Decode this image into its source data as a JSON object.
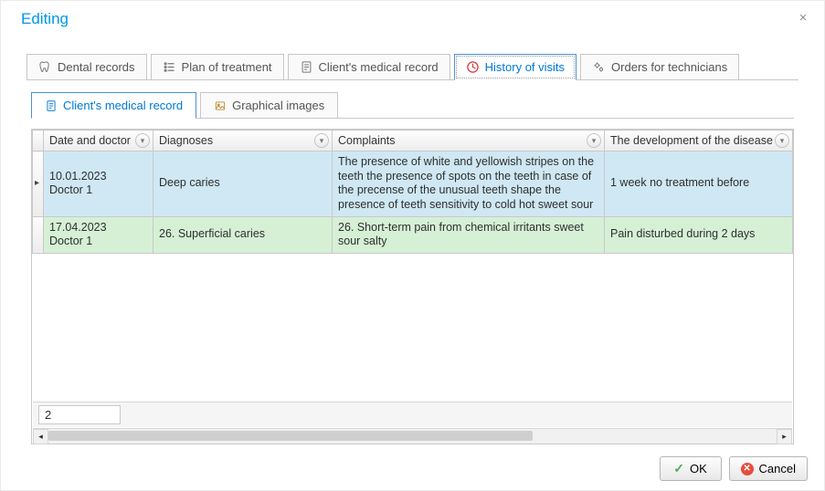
{
  "window": {
    "title": "Editing",
    "close_label": "×"
  },
  "tabs": [
    {
      "label": "Dental records"
    },
    {
      "label": "Plan of treatment"
    },
    {
      "label": "Client's medical record"
    },
    {
      "label": "History of visits",
      "active": true
    },
    {
      "label": "Orders for technicians"
    }
  ],
  "subtabs": [
    {
      "label": "Client's medical record",
      "active": true
    },
    {
      "label": "Graphical images"
    }
  ],
  "grid": {
    "columns": [
      "Date and doctor",
      "Diagnoses",
      "Complaints",
      "The development of the disease"
    ],
    "rows": [
      {
        "selected": true,
        "date_doctor_line1": "10.01.2023",
        "date_doctor_line2": "Doctor 1",
        "diagnoses": "Deep caries",
        "complaints": "The presence of white and yellowish stripes on the teeth the presence of spots on the teeth in case of the precense of the unusual teeth shape the presence of teeth sensitivity to cold hot sweet sour",
        "development": "1 week no treatment before"
      },
      {
        "date_doctor_line1": "17.04.2023",
        "date_doctor_line2": "Doctor 1",
        "diagnoses": "26. Superficial caries",
        "complaints": "26. Short-term pain from chemical irritants sweet sour salty",
        "development": "Pain disturbed during 2 days"
      }
    ],
    "footer_count": "2"
  },
  "buttons": {
    "ok": "OK",
    "cancel": "Cancel"
  }
}
